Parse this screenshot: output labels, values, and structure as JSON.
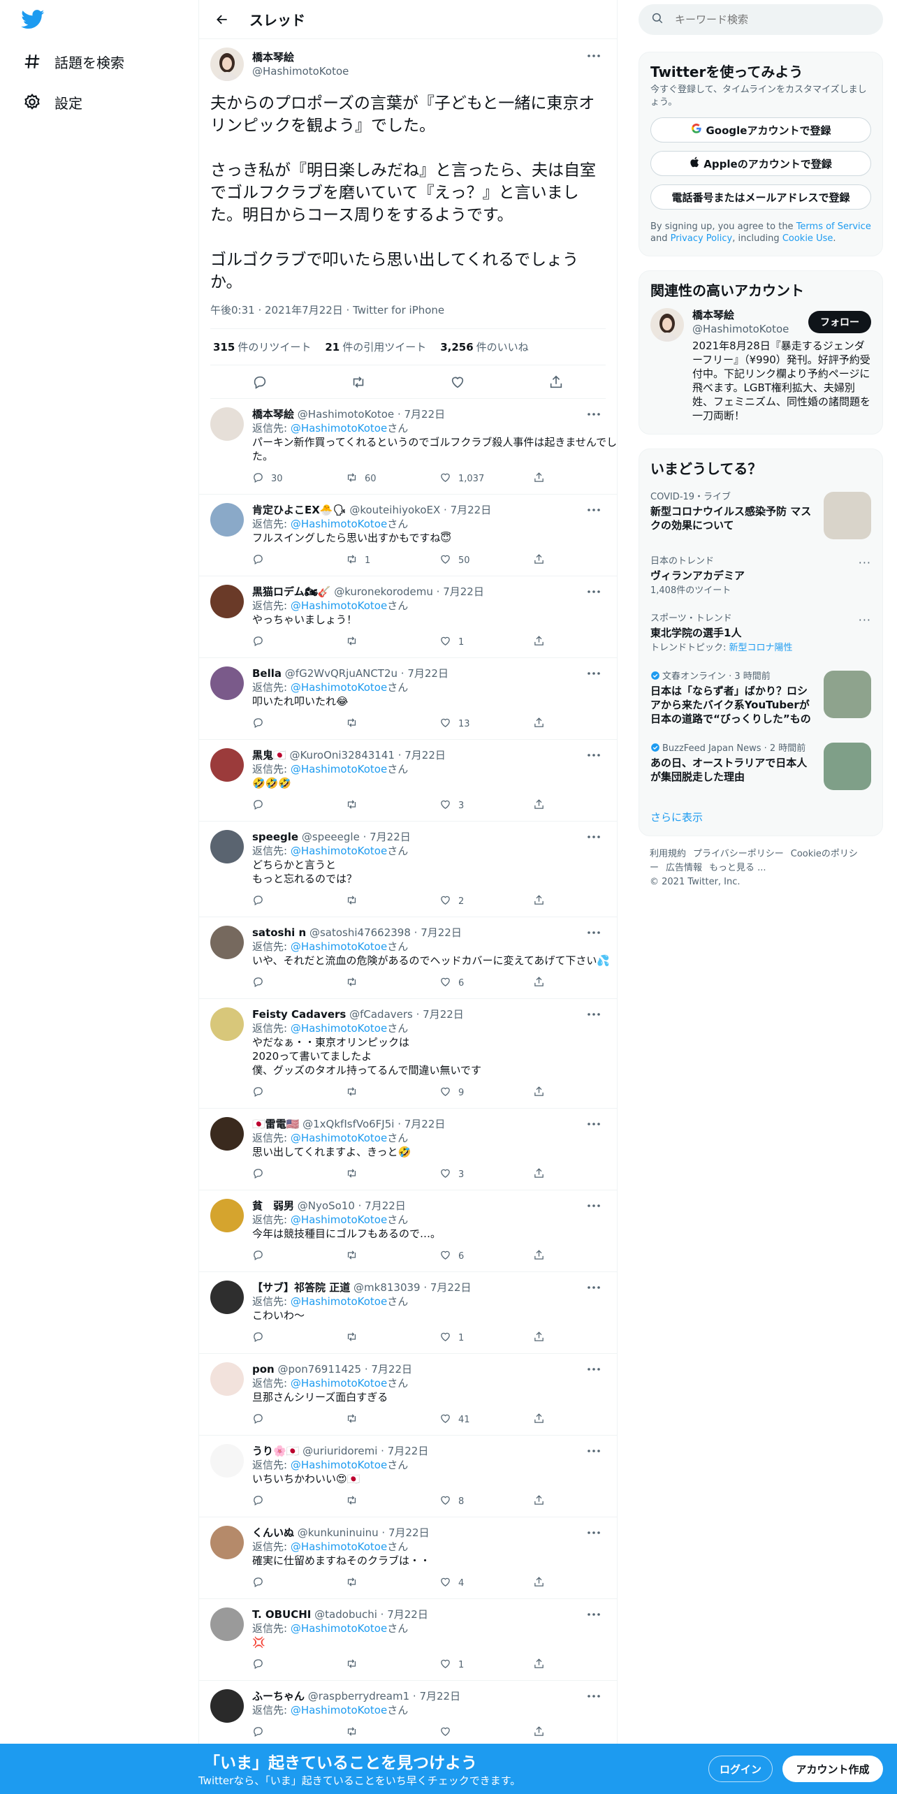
{
  "nav": {
    "logo_color": "#1d9bf0",
    "items": [
      {
        "label": "話題を検索",
        "icon": "hashtag-icon"
      },
      {
        "label": "設定",
        "icon": "gear-icon"
      }
    ]
  },
  "header": {
    "title": "スレッド"
  },
  "main_tweet": {
    "name": "橋本琴絵",
    "handle": "@HashimotoKotoe",
    "text": "夫からのプロポーズの言葉が『子どもと一緒に東京オリンピックを観よう』でした。\n\nさっき私が『明日楽しみだね』と言ったら、夫は自室でゴルフクラブを磨いていて『えっ？』と言いました。明日からコース周りをするようです。\n\nゴルゴクラブで叩いたら思い出してくれるでしょうか。",
    "meta": "午後0:31 · 2021年7月22日 · Twitter for iPhone",
    "retweets_count": "315",
    "retweets_label": "件のリツイート",
    "quotes_count": "21",
    "quotes_label": "件の引用ツイート",
    "likes_count": "3,256",
    "likes_label": "件のいいね"
  },
  "replies": [
    {
      "name": "橋本琴絵",
      "handle": "@HashimotoKotoe",
      "date": "7月22日",
      "to_prefix": "返信先: ",
      "to": "@HashimotoKotoe",
      "to_suffix": "さん",
      "text": "パーキン新作買ってくれるというのでゴルフクラブ殺人事件は起きませんでした。",
      "replies": "30",
      "retweets": "60",
      "likes": "1,037"
    },
    {
      "name": "肯定ひよこEX🐣🗣",
      "handle": "@kouteihiyokoEX",
      "date": "7月22日",
      "to_prefix": "返信先: ",
      "to": "@HashimotoKotoe",
      "to_suffix": "さん",
      "text": "フルスイングしたら思い出すかもですね😇",
      "replies": "",
      "retweets": "1",
      "likes": "50"
    },
    {
      "name": "黒猫ロデム🏍🎸",
      "handle": "@kuronekorodemu",
      "date": "7月22日",
      "to_prefix": "返信先: ",
      "to": "@HashimotoKotoe",
      "to_suffix": "さん",
      "text": "やっちゃいましょう！",
      "replies": "",
      "retweets": "",
      "likes": "1"
    },
    {
      "name": "Bella",
      "handle": "@fG2WvQRjuANCT2u",
      "date": "7月22日",
      "to_prefix": "返信先: ",
      "to": "@HashimotoKotoe",
      "to_suffix": "さん",
      "text": "叩いたれ叩いたれ😂",
      "replies": "",
      "retweets": "",
      "likes": "13"
    },
    {
      "name": "黒鬼🇯🇵",
      "handle": "@KuroOni32843141",
      "date": "7月22日",
      "to_prefix": "返信先: ",
      "to": "@HashimotoKotoe",
      "to_suffix": "さん",
      "text": "🤣🤣🤣",
      "replies": "",
      "retweets": "",
      "likes": "3"
    },
    {
      "name": "speegle",
      "handle": "@speeegle",
      "date": "7月22日",
      "to_prefix": "返信先: ",
      "to": "@HashimotoKotoe",
      "to_suffix": "さん",
      "text": "どちらかと言うと\nもっと忘れるのでは？",
      "replies": "",
      "retweets": "",
      "likes": "2"
    },
    {
      "name": "satoshi n",
      "handle": "@satoshi47662398",
      "date": "7月22日",
      "to_prefix": "返信先: ",
      "to": "@HashimotoKotoe",
      "to_suffix": "さん",
      "text": "いや、それだと流血の危険があるのでヘッドカバーに変えてあげて下さい💦",
      "replies": "",
      "retweets": "",
      "likes": "6"
    },
    {
      "name": "Feisty Cadavers",
      "handle": "@fCadavers",
      "date": "7月22日",
      "to_prefix": "返信先: ",
      "to": "@HashimotoKotoe",
      "to_suffix": "さん",
      "text": "やだなぁ・・東京オリンピックは\n2020って書いてましたよ\n僕、グッズのタオル持ってるんで間違い無いです",
      "replies": "",
      "retweets": "",
      "likes": "9"
    },
    {
      "name": "🇯🇵雷電🇺🇸",
      "handle": "@1xQkfIsfVo6FJ5i",
      "date": "7月22日",
      "to_prefix": "返信先: ",
      "to": "@HashimotoKotoe",
      "to_suffix": "さん",
      "text": "思い出してくれますよ、きっと🤣",
      "replies": "",
      "retweets": "",
      "likes": "3"
    },
    {
      "name": "貧　弱男",
      "handle": "@NyoSo10",
      "date": "7月22日",
      "to_prefix": "返信先: ",
      "to": "@HashimotoKotoe",
      "to_suffix": "さん",
      "text": "今年は競技種目にゴルフもあるので…。",
      "replies": "",
      "retweets": "",
      "likes": "6"
    },
    {
      "name": "【サブ】祁答院 正道",
      "handle": "@mk813039",
      "date": "7月22日",
      "to_prefix": "返信先: ",
      "to": "@HashimotoKotoe",
      "to_suffix": "さん",
      "text": "こわいわ～",
      "replies": "",
      "retweets": "",
      "likes": "1"
    },
    {
      "name": "pon",
      "handle": "@pon76911425",
      "date": "7月22日",
      "to_prefix": "返信先: ",
      "to": "@HashimotoKotoe",
      "to_suffix": "さん",
      "text": "旦那さんシリーズ面白すぎる",
      "replies": "",
      "retweets": "",
      "likes": "41"
    },
    {
      "name": "うり🌸🇯🇵",
      "handle": "@uriuridoremi",
      "date": "7月22日",
      "to_prefix": "返信先: ",
      "to": "@HashimotoKotoe",
      "to_suffix": "さん",
      "text": "いちいちかわいい😍🇯🇵",
      "replies": "",
      "retweets": "",
      "likes": "8"
    },
    {
      "name": "くんいぬ",
      "handle": "@kunkuninuinu",
      "date": "7月22日",
      "to_prefix": "返信先: ",
      "to": "@HashimotoKotoe",
      "to_suffix": "さん",
      "text": "確実に仕留めますねそのクラブは・・",
      "replies": "",
      "retweets": "",
      "likes": "4"
    },
    {
      "name": "T. OBUCHI",
      "handle": "@tadobuchi",
      "date": "7月22日",
      "to_prefix": "返信先: ",
      "to": "@HashimotoKotoe",
      "to_suffix": "さん",
      "text": "💢",
      "replies": "",
      "retweets": "",
      "likes": "1"
    },
    {
      "name": "ふーちゃん",
      "handle": "@raspberrydream1",
      "date": "7月22日",
      "to_prefix": "返信先: ",
      "to": "@HashimotoKotoe",
      "to_suffix": "さん",
      "text": "",
      "replies": "",
      "retweets": "",
      "likes": ""
    }
  ],
  "sidebar": {
    "search_placeholder": "キーワード検索",
    "signup": {
      "title": "Twitterを使ってみよう",
      "subtitle": "今すぐ登録して、タイムラインをカスタマイズしましょう。",
      "google_label": "Googleアカウントで登録",
      "apple_label": "Appleのアカウントで登録",
      "phone_label": "電話番号またはメールアドレスで登録",
      "terms_prefix": "By signing up, you agree to the ",
      "terms_link": "Terms of Service",
      "terms_and": " and ",
      "privacy_link": "Privacy Policy",
      "terms_including": ", including ",
      "cookie_link": "Cookie Use",
      "terms_end": "."
    },
    "related": {
      "title": "関連性の高いアカウント",
      "name": "橋本琴絵",
      "handle": "@HashimotoKotoe",
      "follow_label": "フォロー",
      "bio": "2021年8月28日『暴走するジェンダーフリー』（¥990）発刊。好評予約受付中。下記リンク欄より予約ページに飛べます。LGBT権利拡大、夫婦別姓、フェミニズム、同性婚の諸問題を一刀両断！"
    },
    "trends": {
      "title": "いまどうしてる？",
      "items": [
        {
          "meta": "COVID-19・ライブ",
          "title": "新型コロナウイルス感染予防 マスクの効果について",
          "sub": "",
          "sub_link": "",
          "has_thumb": true,
          "thumb_color": "#d9d4ca",
          "verified": false
        },
        {
          "meta": "日本のトレンド",
          "title": "ヴィランアカデミア",
          "sub": "1,408件のツイート",
          "sub_link": "",
          "has_thumb": false,
          "thumb_color": "",
          "verified": false
        },
        {
          "meta": "スポーツ・トレンド",
          "title": "東北学院の選手1人",
          "sub": "トレンドトピック: ",
          "sub_link": "新型コロナ陽性",
          "has_thumb": false,
          "thumb_color": "",
          "verified": false
        },
        {
          "meta": "文春オンライン · 3 時間前",
          "title": "日本は「ならず者」ばかり？ロシアから来たバイク系YouTuberが日本の道路で“びっくりした”もの",
          "sub": "",
          "sub_link": "",
          "has_thumb": true,
          "thumb_color": "#8ea38d",
          "verified": true
        },
        {
          "meta": "BuzzFeed Japan News · 2 時間前",
          "title": "あの日、オーストラリアで日本人が集団脱走した理由",
          "sub": "",
          "sub_link": "",
          "has_thumb": true,
          "thumb_color": "#7f9f88",
          "verified": true
        }
      ],
      "show_more": "さらに表示"
    },
    "footer": {
      "links": [
        "利用規約",
        "プライバシーポリシー",
        "Cookieのポリシー",
        "広告情報",
        "もっと見る ..."
      ],
      "copyright": "© 2021 Twitter, Inc."
    }
  },
  "bottom_bar": {
    "title": "「いま」起きていることを見つけよう",
    "subtitle": "Twitterなら、「いま」起きていることをいち早くチェックできます。",
    "login_label": "ログイン",
    "signup_label": "アカウント作成",
    "color": "#1d9bf0"
  }
}
